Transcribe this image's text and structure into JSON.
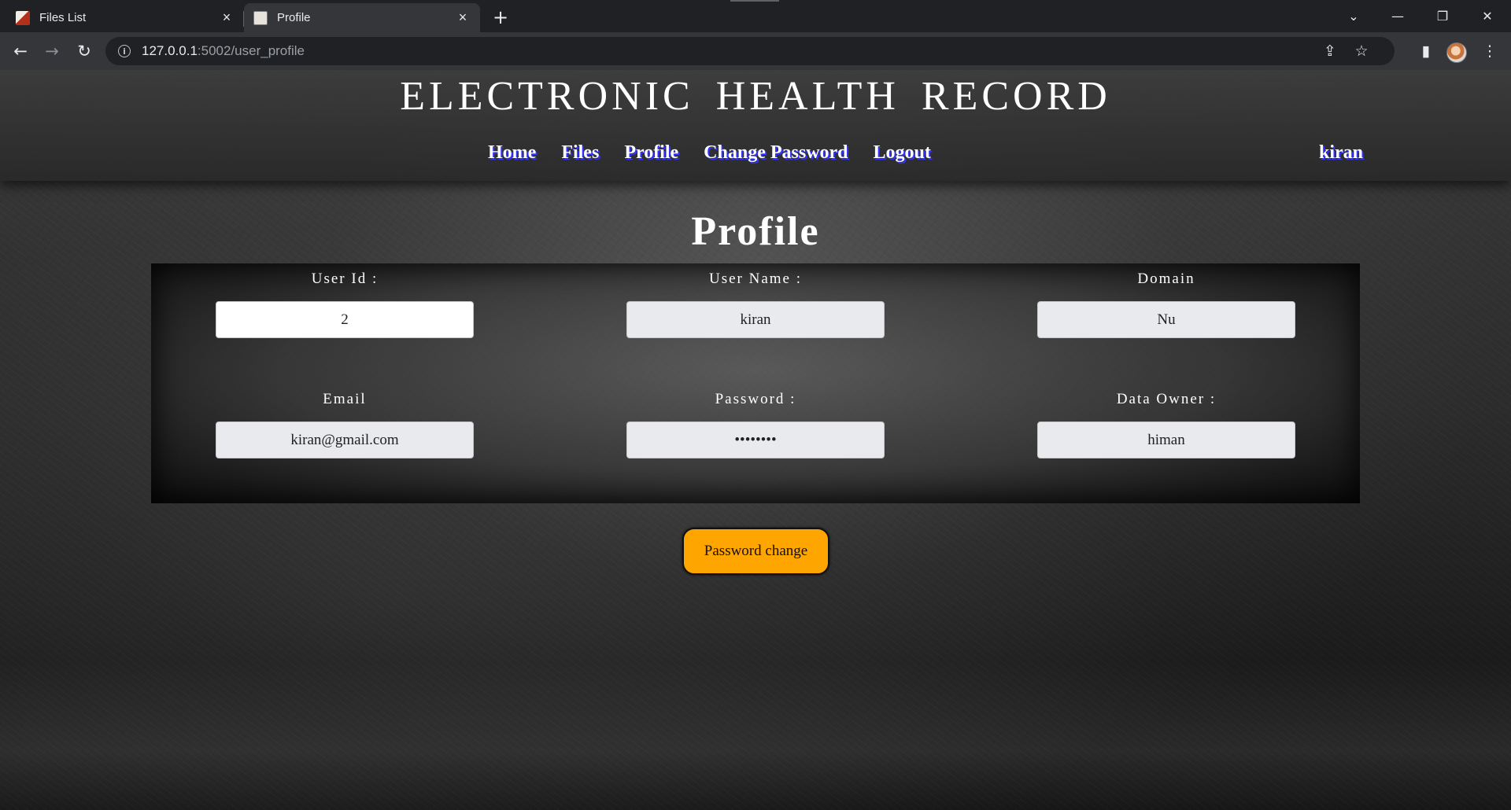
{
  "browser": {
    "tabs": [
      {
        "title": "Files List",
        "active": false
      },
      {
        "title": "Profile",
        "active": true
      }
    ],
    "url_host": "127.0.0.1",
    "url_path": ":5002/user_profile",
    "icons": {
      "tab_close": "×",
      "new_tab": "+",
      "minimize": "—",
      "restore": "❐",
      "close": "✕",
      "tab_search": "⌄",
      "back": "←",
      "forward": "→",
      "reload": "↻",
      "info": "i",
      "share": "⇪",
      "star": "☆",
      "side_panel": "▮",
      "menu": "⋮"
    }
  },
  "site": {
    "title": "ELECTRONIC HEALTH RECORD",
    "nav": [
      "Home",
      "Files",
      "Profile",
      "Change Password",
      "Logout"
    ],
    "user": "kiran"
  },
  "profile": {
    "heading": "Profile",
    "fields": [
      {
        "label": "User Id :",
        "value": "2"
      },
      {
        "label": "User Name :",
        "value": "kiran"
      },
      {
        "label": "Domain",
        "value": "Nu"
      },
      {
        "label": "Email",
        "value": "kiran@gmail.com"
      },
      {
        "label": "Password :",
        "value": "••••••••"
      },
      {
        "label": "Data Owner :",
        "value": "himan"
      }
    ],
    "button": "Password change"
  },
  "colors": {
    "button_bg": "#ffa500",
    "nav_shadow": "#3333ff",
    "page_bg": "#2c2c2c"
  }
}
